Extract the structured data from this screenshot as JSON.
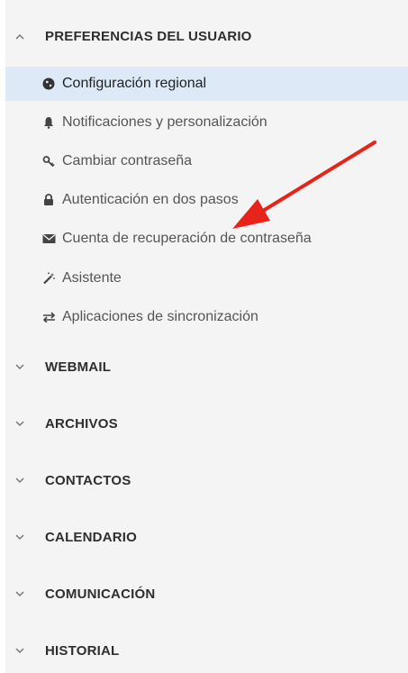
{
  "sections": {
    "user_prefs": {
      "title": "PREFERENCIAS DEL USUARIO",
      "expanded": true
    },
    "webmail": {
      "title": "WEBMAIL"
    },
    "archivos": {
      "title": "ARCHIVOS"
    },
    "contactos": {
      "title": "CONTACTOS"
    },
    "calendario": {
      "title": "CALENDARIO"
    },
    "comunicacion": {
      "title": "COMUNICACIÓN"
    },
    "historial": {
      "title": "HISTORIAL"
    }
  },
  "items": [
    {
      "label": "Configuración regional",
      "icon": "globe-icon",
      "active": true
    },
    {
      "label": "Notificaciones y personalización",
      "icon": "bell-icon"
    },
    {
      "label": "Cambiar contraseña",
      "icon": "key-icon"
    },
    {
      "label": "Autenticación en dos pasos",
      "icon": "lock-icon"
    },
    {
      "label": "Cuenta de recuperación de contraseña",
      "icon": "envelope-icon"
    },
    {
      "label": "Asistente",
      "icon": "magic-wand-icon"
    },
    {
      "label": "Aplicaciones de sincronización",
      "icon": "sync-arrows-icon"
    }
  ],
  "colors": {
    "active_bg": "#dde9f6",
    "panel_bg": "#f4f4f4",
    "annotation_arrow": "#e8231a"
  }
}
